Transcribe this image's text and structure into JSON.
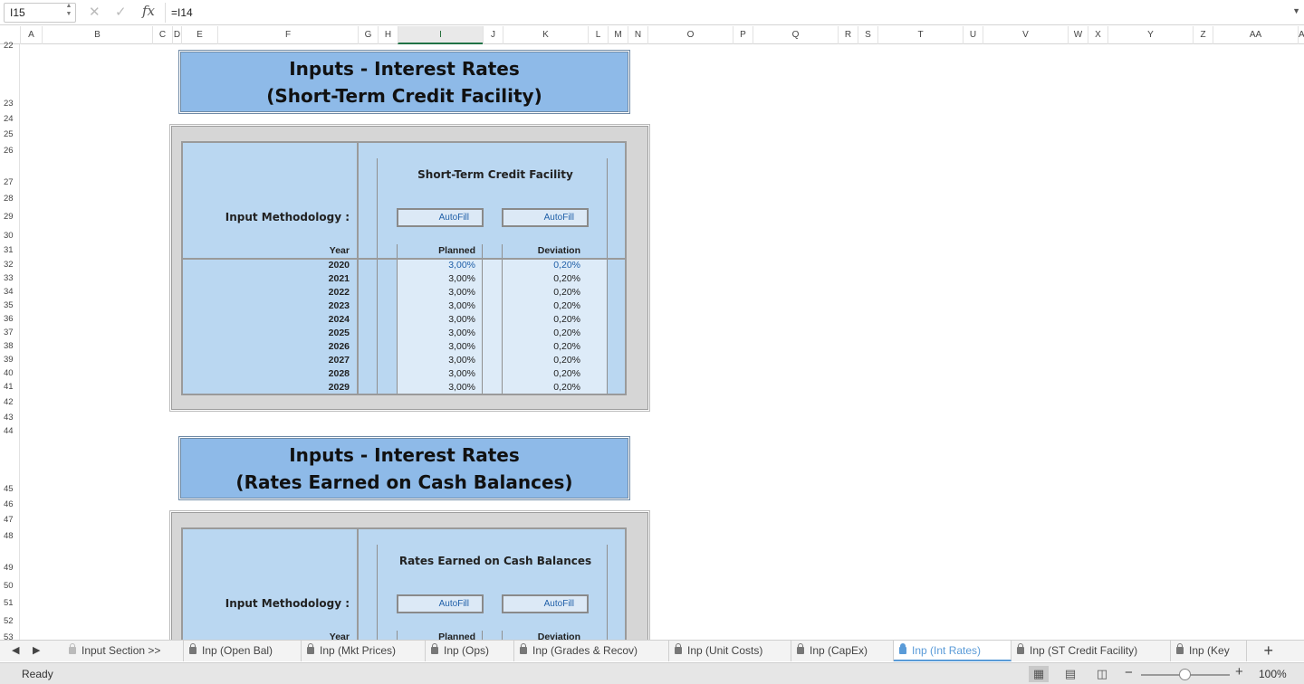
{
  "formula_bar": {
    "name_box": "I15",
    "formula": "=I14",
    "icons": [
      "cancel-icon",
      "enter-icon",
      "fx-icon"
    ]
  },
  "columns": [
    "A",
    "B",
    "C",
    "D",
    "E",
    "F",
    "G",
    "H",
    "I",
    "J",
    "K",
    "L",
    "M",
    "N",
    "O",
    "P",
    "Q",
    "R",
    "S",
    "T",
    "U",
    "V",
    "W",
    "X",
    "Y",
    "Z",
    "AA",
    "A"
  ],
  "active_column": "I",
  "rows": [
    "22",
    "23",
    "24",
    "25",
    "26",
    "27",
    "28",
    "29",
    "30",
    "31",
    "32",
    "33",
    "34",
    "35",
    "36",
    "37",
    "38",
    "39",
    "40",
    "41",
    "42",
    "43",
    "44",
    "45",
    "46",
    "47",
    "48",
    "49",
    "50",
    "51",
    "52",
    "53"
  ],
  "section1": {
    "title_line1": "Inputs - Interest Rates",
    "title_line2": "(Short-Term Credit Facility)",
    "table_title": "Short-Term Credit Facility",
    "method_label": "Input Methodology :",
    "autofill_planned": "AutoFill",
    "autofill_deviation": "AutoFill",
    "col_year": "Year",
    "col_planned": "Planned",
    "col_deviation": "Deviation",
    "years": [
      "2020",
      "2021",
      "2022",
      "2023",
      "2024",
      "2025",
      "2026",
      "2027",
      "2028",
      "2029"
    ],
    "planned": [
      "3,00%",
      "3,00%",
      "3,00%",
      "3,00%",
      "3,00%",
      "3,00%",
      "3,00%",
      "3,00%",
      "3,00%",
      "3,00%"
    ],
    "deviation": [
      "0,20%",
      "0,20%",
      "0,20%",
      "0,20%",
      "0,20%",
      "0,20%",
      "0,20%",
      "0,20%",
      "0,20%",
      "0,20%"
    ]
  },
  "section2": {
    "title_line1": "Inputs - Interest Rates",
    "title_line2": "(Rates Earned on Cash Balances)",
    "table_title": "Rates Earned on Cash Balances",
    "method_label": "Input Methodology :",
    "autofill_planned": "AutoFill",
    "autofill_deviation": "AutoFill",
    "col_year": "Year",
    "col_planned": "Planned",
    "col_deviation": "Deviation"
  },
  "tabs": [
    {
      "label": "Input Section >>",
      "active": false
    },
    {
      "label": "Inp (Open Bal)",
      "active": false
    },
    {
      "label": "Inp (Mkt Prices)",
      "active": false
    },
    {
      "label": "Inp (Ops)",
      "active": false
    },
    {
      "label": "Inp (Grades & Recov)",
      "active": false
    },
    {
      "label": "Inp (Unit Costs)",
      "active": false
    },
    {
      "label": "Inp (CapEx)",
      "active": false
    },
    {
      "label": "Inp (Int Rates)",
      "active": true
    },
    {
      "label": "Inp (ST Credit Facility)",
      "active": false
    },
    {
      "label": "Inp (Key",
      "active": false
    }
  ],
  "status": {
    "text": "Ready",
    "zoom": "100%",
    "zoom_fraction": 0.5
  },
  "colors": {
    "banner": "#8ebae8",
    "panel": "#d6d6d6",
    "table": "#bad7f1",
    "input_cell": "#ddebf8",
    "input_text": "#1f5fa8",
    "active_tab": "#5a9bd8"
  }
}
